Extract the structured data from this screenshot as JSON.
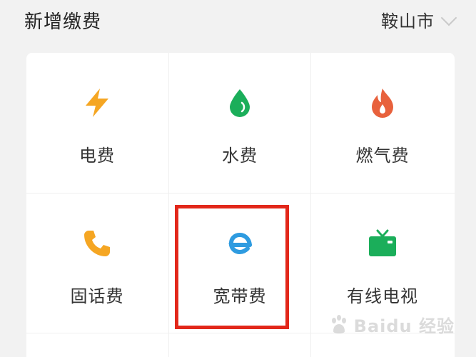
{
  "header": {
    "title": "新增缴费",
    "city_label": "鞍山市",
    "chevron_icon": "chevron-down-icon"
  },
  "payment_types": [
    {
      "label": "电费",
      "icon": "lightning-icon",
      "color": "#F5A623"
    },
    {
      "label": "水费",
      "icon": "water-drop-icon",
      "color": "#1BAE5A"
    },
    {
      "label": "燃气费",
      "icon": "flame-icon",
      "color": "#E8613C"
    },
    {
      "label": "固话费",
      "icon": "phone-icon",
      "color": "#F5A623"
    },
    {
      "label": "宽带费",
      "icon": "broadband-e-icon",
      "color": "#2E9BE0"
    },
    {
      "label": "有线电视",
      "icon": "tv-icon",
      "color": "#1BAE5A"
    }
  ],
  "highlight": {
    "target": "宽带费",
    "color": "#E2271A"
  },
  "watermark": {
    "text": "Baidu 经验"
  }
}
